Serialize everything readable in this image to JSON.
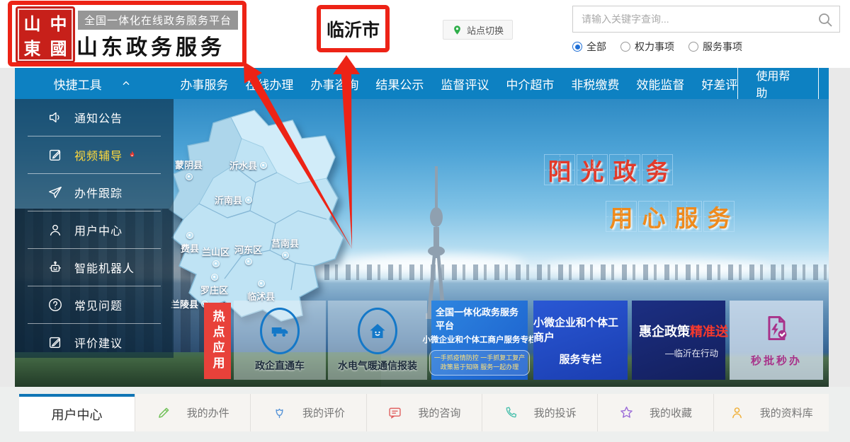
{
  "header": {
    "seal_chars": [
      "山",
      "中",
      "東",
      "國"
    ],
    "platform_badge": "全国一体化在线政务服务平台",
    "site_title": "山东政务服务",
    "city_highlight": "临沂市",
    "site_switch_label": "站点切换",
    "search_placeholder": "请输入关键字查询...",
    "filter_all": "全部",
    "filter_power": "权力事项",
    "filter_service": "服务事项"
  },
  "nav": {
    "quick_tools": "快捷工具",
    "items": [
      "办事服务",
      "在线办理",
      "办事咨询",
      "结果公示",
      "监督评议",
      "中介超市",
      "非税缴费",
      "效能监督",
      "好差评"
    ],
    "help_button": "使用帮助"
  },
  "sidebar": {
    "items": [
      "通知公告",
      "视频辅导",
      "办件跟踪",
      "用户中心",
      "智能机器人",
      "常见问题",
      "评价建议"
    ]
  },
  "map": {
    "districts": [
      "蒙阴县",
      "沂水县",
      "沂南县",
      "费县",
      "兰山区",
      "河东区",
      "莒南县",
      "罗庄区",
      "临沭县",
      "兰陵县"
    ]
  },
  "slogan": {
    "line1": [
      "阳",
      "光",
      "政",
      "务"
    ],
    "line2": [
      "用",
      "心",
      "服",
      "务"
    ]
  },
  "hot_apps": {
    "tab": "热点应用",
    "card1": "政企直通车",
    "card2": "水电气暖通信报装",
    "card3_line1": "全国一体化政务服务平台",
    "card3_line2": "小微企业和个体工商户服务专栏",
    "card3_sub1": "一手抓疫情防控 一手抓复工复产",
    "card3_sub2": "政策易于知晓 服务一起办理",
    "card4_line1": "小微企业和个体工商户",
    "card4_line2": "服务专栏",
    "card5_white": "惠企政策",
    "card5_red": "精准送",
    "card5_sub": "—临沂在行动",
    "card6": "秒批秒办"
  },
  "bottom_bar": {
    "active_tab": "用户中心",
    "items": [
      "我的办件",
      "我的评价",
      "我的咨询",
      "我的投诉",
      "我的收藏",
      "我的资料库"
    ]
  },
  "colors": {
    "nav_blue": "#0d81c2",
    "annotation_red": "#ed2316",
    "hot_tab_red": "#e8413a",
    "slogan_red": "#e23a2a",
    "slogan_orange": "#ef8a1c",
    "card6_magenta": "#a8328a"
  }
}
